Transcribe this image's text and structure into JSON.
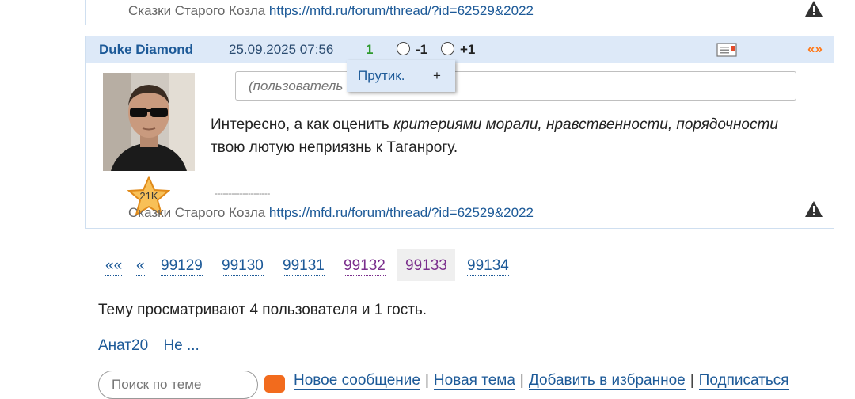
{
  "prev_post": {
    "signature_text": "Сказки Старого Козла",
    "signature_link": "https://mfd.ru/forum/thread/?id=62529&2022"
  },
  "post": {
    "author": "Duke Diamond",
    "date": "25.09.2025 07:56",
    "rating": "1",
    "vote_minus": "-1",
    "vote_plus": "+1",
    "quote_label": "«»",
    "reply_placeholder": "(пользователь",
    "text_before": "Интересно, а как оценить ",
    "text_italic": "критериями морали, нравственности, порядочности",
    "text_after": " твою лютую неприязнь к Таганрогу.",
    "badge_label": "21K",
    "signature_separator": "--------------------",
    "signature_text": "Сказки Старого Козла",
    "signature_link": "https://mfd.ru/forum/thread/?id=62529&2022"
  },
  "dropdown": {
    "item": "Прутик.",
    "add": "+"
  },
  "pager": {
    "first": "««",
    "prev": "«",
    "pages": [
      "99129",
      "99130",
      "99131",
      "99132",
      "99133",
      "99134"
    ],
    "current": "99133"
  },
  "viewers": {
    "summary": "Тему просматривают 4 пользователя и 1 гость.",
    "names": [
      "Анат20",
      "Не ..."
    ]
  },
  "bottom_bar": {
    "search_placeholder": "Поиск по теме",
    "links": [
      "Новое сообщение",
      "Новая тема",
      "Добавить в избранное",
      "Подписаться"
    ]
  },
  "colors": {
    "link": "#1d5a98",
    "visited": "#7a2e8c",
    "header_bg": "#dde9f8",
    "rating_green": "#2e9a2e",
    "quote_orange": "#ff7a1a"
  }
}
